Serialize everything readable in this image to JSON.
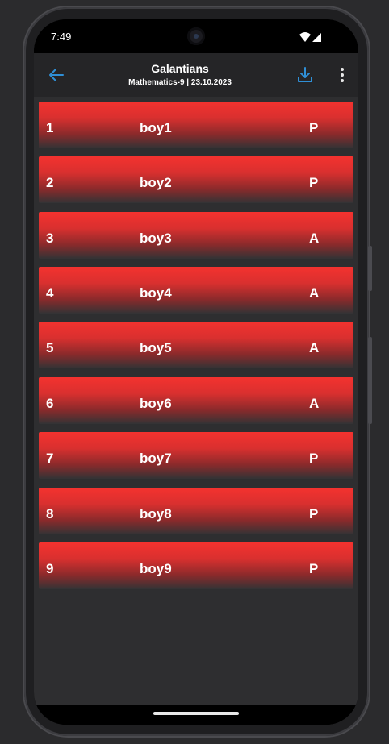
{
  "status_bar": {
    "time": "7:49"
  },
  "app_bar": {
    "title": "Galantians",
    "subtitle": "Mathematics-9  | 23.10.2023",
    "back_icon": "arrow-left-icon",
    "download_icon": "download-icon",
    "more_icon": "more-vertical-icon",
    "accent_color": "#2f8fd6"
  },
  "attendance": [
    {
      "number": "1",
      "name": "boy1",
      "status": "P"
    },
    {
      "number": "2",
      "name": "boy2",
      "status": "P"
    },
    {
      "number": "3",
      "name": "boy3",
      "status": "A"
    },
    {
      "number": "4",
      "name": "boy4",
      "status": "A"
    },
    {
      "number": "5",
      "name": "boy5",
      "status": "A"
    },
    {
      "number": "6",
      "name": "boy6",
      "status": "A"
    },
    {
      "number": "7",
      "name": "boy7",
      "status": "P"
    },
    {
      "number": "8",
      "name": "boy8",
      "status": "P"
    },
    {
      "number": "9",
      "name": "boy9",
      "status": "P"
    }
  ],
  "colors": {
    "row_red": "#f4322f",
    "background": "#2e2e30",
    "app_bar": "#252527"
  }
}
